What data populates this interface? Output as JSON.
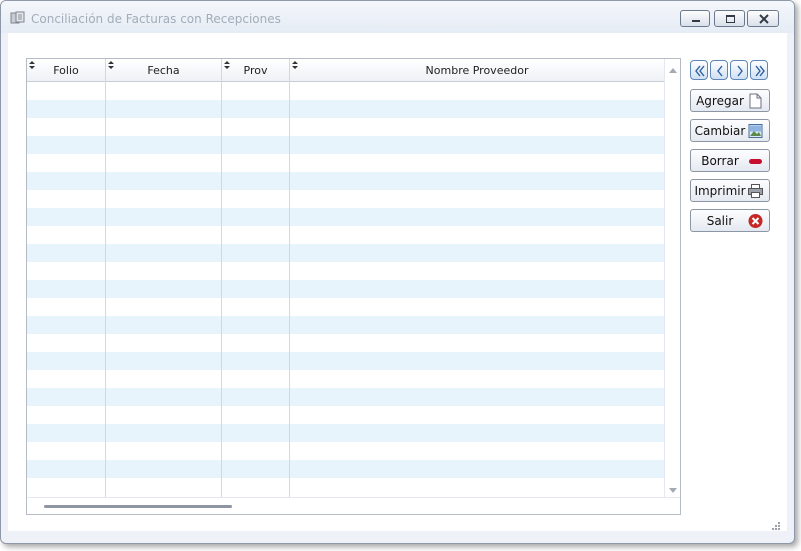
{
  "window": {
    "title": "Conciliación de Facturas con Recepciones",
    "icon": "invoices-app-icon",
    "controls": [
      "minimize-icon",
      "restore-icon",
      "close-icon"
    ]
  },
  "grid": {
    "columns": [
      {
        "label": "Folio"
      },
      {
        "label": "Fecha"
      },
      {
        "label": "Prov"
      },
      {
        "label": "Nombre Proveedor"
      }
    ],
    "rows": [],
    "row_stripe_color": "#e8f4fc"
  },
  "navigation": {
    "buttons": [
      "first-record-icon",
      "previous-record-icon",
      "next-record-icon",
      "last-record-icon"
    ]
  },
  "actions": [
    {
      "label": "Agregar",
      "icon": "new-document-icon"
    },
    {
      "label": "Cambiar",
      "icon": "edit-picture-icon"
    },
    {
      "label": "Borrar",
      "icon": "delete-minus-icon"
    },
    {
      "label": "Imprimir",
      "icon": "printer-icon"
    },
    {
      "label": "Salir",
      "icon": "exit-x-icon"
    }
  ],
  "colors": {
    "accent": "#5f86b8",
    "delete": "#c8102e",
    "exit": "#c62828"
  }
}
